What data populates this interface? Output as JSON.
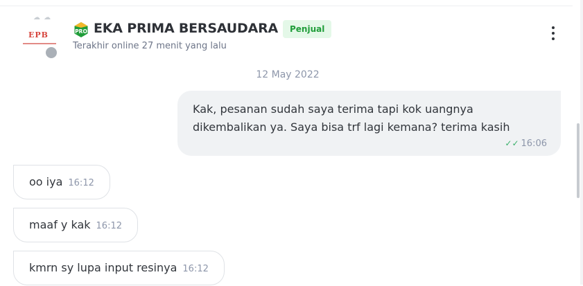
{
  "header": {
    "avatar_text": "EPB",
    "shop_name": "EKA PRIMA BERSAUDARA",
    "role_badge": "Penjual",
    "pro_badge": "PRO",
    "last_online": "Terakhir online 27 menit yang lalu"
  },
  "chat": {
    "date": "12 May 2022",
    "messages": [
      {
        "direction": "out",
        "text": "Kak, pesanan sudah saya terima tapi kok uangnya dikembalikan ya. Saya bisa trf lagi kemana? terima kasih",
        "time": "16:06",
        "status": "read"
      },
      {
        "direction": "in",
        "text": "oo iya",
        "time": "16:12"
      },
      {
        "direction": "in",
        "text": "maaf y kak",
        "time": "16:12"
      },
      {
        "direction": "in",
        "text": "kmrn sy lupa input resinya",
        "time": "16:12"
      }
    ]
  },
  "colors": {
    "accent_green": "#1f9d39",
    "badge_bg": "#e4f8e8",
    "bubble_out_bg": "#f0f2f4",
    "read_check": "#3bb16b"
  },
  "icons": {
    "more": "more-vertical-icon",
    "read": "double-check-icon",
    "pro": "pro-badge-icon"
  }
}
